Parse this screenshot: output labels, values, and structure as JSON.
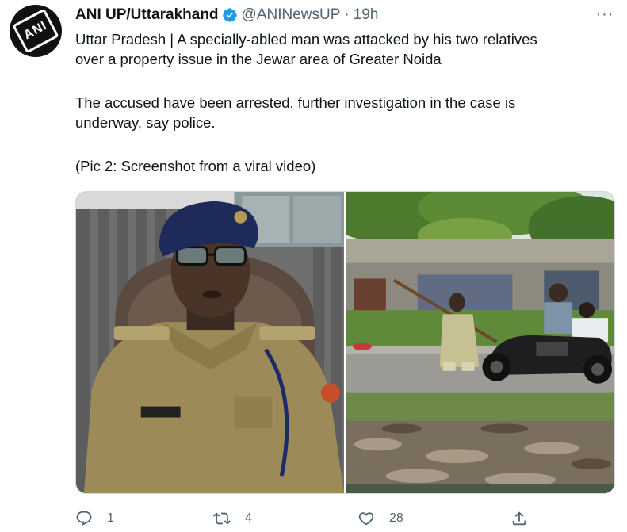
{
  "tweet": {
    "display_name": "ANI UP/Uttarakhand",
    "handle": "@ANINewsUP",
    "separator": "·",
    "time": "19h",
    "avatar_text": "ANI",
    "lines": [
      "Uttar Pradesh | A specially-abled man was attacked by his two relatives",
      "over a property issue in the Jewar area of Greater Noida",
      "The accused have been arrested, further investigation in the case is",
      "underway, say police.",
      "(Pic 2: Screenshot from a viral video)"
    ],
    "more_label": "···",
    "media": [
      {
        "name": "Police officer photo"
      },
      {
        "name": "Viral video screenshot"
      }
    ],
    "actions": {
      "reply_count": "1",
      "retweet_count": "4",
      "like_count": "28"
    },
    "icons": {
      "verified": "verified-badge-icon",
      "more": "more-dots-icon",
      "reply": "reply-icon",
      "retweet": "retweet-icon",
      "like": "heart-icon",
      "share": "share-icon"
    },
    "colors": {
      "verified": "#1d9bf0",
      "secondary_text": "#536471",
      "primary_text": "#0f1419"
    }
  }
}
